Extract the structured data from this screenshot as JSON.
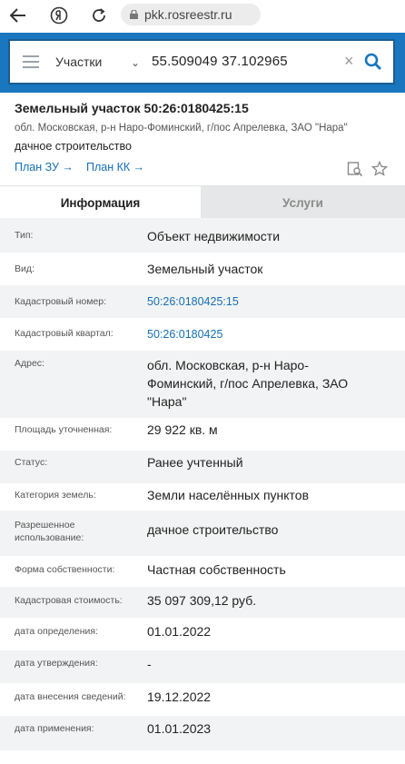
{
  "browser": {
    "url": "pkk.rosreestr.ru"
  },
  "search": {
    "mode": "Участки",
    "query": "55.509049 37.102965"
  },
  "object": {
    "title": "Земельный участок 50:26:0180425:15",
    "address": "обл. Московская, р-н Наро-Фоминский, г/пос Апрелевка, ЗАО \"Нара\"",
    "use": "дачное строительство",
    "plan_zu": "План ЗУ →",
    "plan_kk": "План КК →"
  },
  "tabs": {
    "info": "Информация",
    "services": "Услуги"
  },
  "info": [
    {
      "label": "Тип:",
      "value": "Объект недвижимости"
    },
    {
      "label": "Вид:",
      "value": "Земельный участок"
    },
    {
      "label": "Кадастровый номер:",
      "value": "50:26:0180425:15"
    },
    {
      "label": "Кадастровый квартал:",
      "value": "50:26:0180425"
    },
    {
      "label": "Адрес:",
      "value": "обл. Московская, р-н Наро-Фоминский, г/пос Апрелевка, ЗАО \"Нара\""
    },
    {
      "label": "Площадь уточненная:",
      "value": "29 922 кв. м"
    },
    {
      "label": "Статус:",
      "value": "Ранее учтенный"
    },
    {
      "label": "Категория земель:",
      "value": "Земли населённых пунктов"
    },
    {
      "label": "Разрешенное использование:",
      "value": "дачное строительство"
    },
    {
      "label": "Форма собственности:",
      "value": "Частная собственность"
    },
    {
      "label": "Кадастровая стоимость:",
      "value": "35 097 309,12 руб."
    },
    {
      "label": "дата определения:",
      "value": "01.01.2022"
    },
    {
      "label": "дата утверждения:",
      "value": "-"
    },
    {
      "label": "дата внесения сведений:",
      "value": "19.12.2022"
    },
    {
      "label": "дата применения:",
      "value": "01.01.2023"
    }
  ],
  "colors": {
    "accent_blue": "#1976bf",
    "link_blue": "#1570b5",
    "row_alt": "#f2f3f4"
  }
}
